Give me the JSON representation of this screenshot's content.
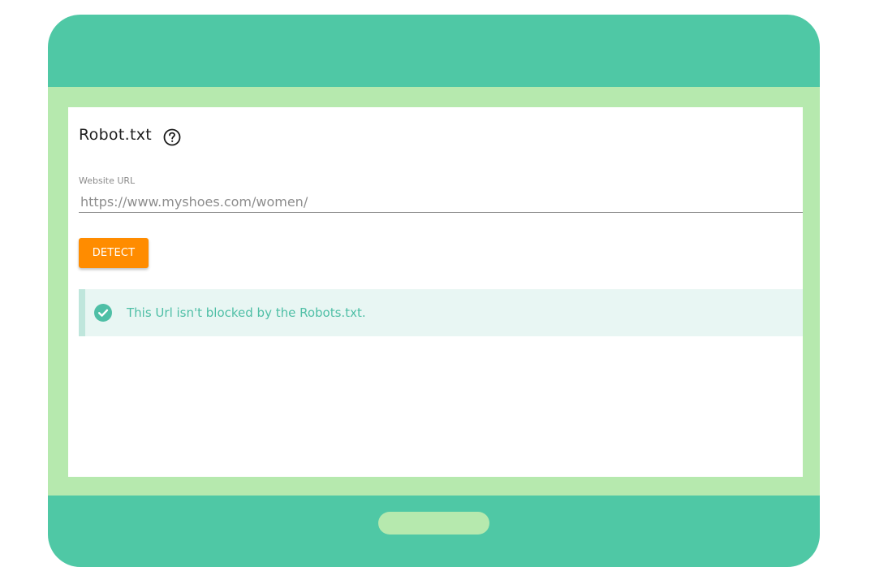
{
  "card": {
    "title": "Robot.txt",
    "help_icon": "help-circle-icon"
  },
  "form": {
    "url_label": "Website URL",
    "url_value": "",
    "url_placeholder": "https://www.myshoes.com/women/",
    "detect_label": "DETECT"
  },
  "result": {
    "status_icon": "check-circle-icon",
    "message": "This Url isn't blocked by the Robots.txt."
  },
  "colors": {
    "device_body": "#4fc8a5",
    "screen_frame": "#b6e9ae",
    "button_accent": "#ff8c00",
    "success_text": "#4fbfa6",
    "success_bg": "#e8f6f3"
  }
}
